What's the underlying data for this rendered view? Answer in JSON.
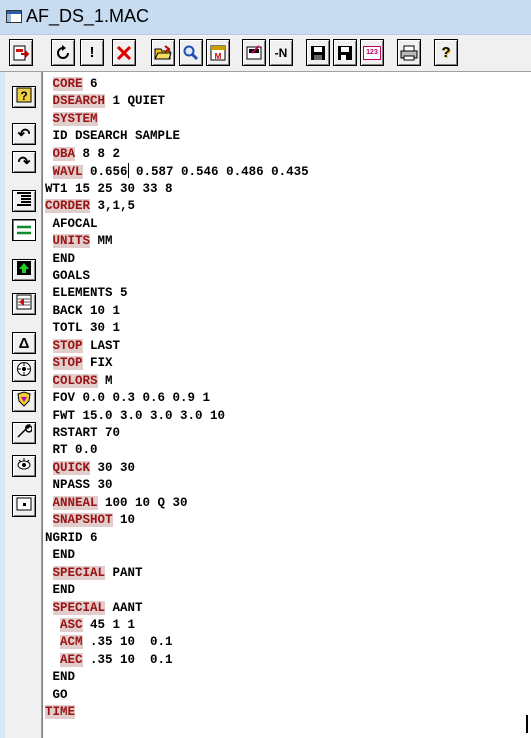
{
  "window": {
    "title": "AF_DS_1.MAC"
  },
  "toolbar": {
    "buttons": [
      {
        "icon": "exit-icon"
      },
      {
        "icon": "refresh-icon"
      },
      {
        "icon": "exclamation-icon",
        "label": "!"
      },
      {
        "icon": "close-red-x-icon"
      },
      {
        "icon": "open-folder-icon"
      },
      {
        "icon": "search-icon"
      },
      {
        "icon": "macro-icon"
      },
      {
        "icon": "edit-icon"
      },
      {
        "icon": "negate-icon",
        "label": "-N"
      },
      {
        "icon": "save-icon"
      },
      {
        "icon": "save-as-icon"
      },
      {
        "icon": "number-icon",
        "label": "123"
      },
      {
        "icon": "print-icon"
      },
      {
        "icon": "help-icon",
        "label": "?"
      }
    ]
  },
  "sidebar": {
    "buttons": [
      {
        "icon": "help-icon",
        "label": "?"
      },
      {
        "icon": "undo-icon",
        "label": "↶"
      },
      {
        "icon": "redo-icon",
        "label": "↷"
      },
      {
        "icon": "indent-icon"
      },
      {
        "icon": "outdent-icon"
      },
      {
        "icon": "up-arrow-icon"
      },
      {
        "icon": "transfer-icon"
      },
      {
        "icon": "triangle-icon",
        "label": "Δ"
      },
      {
        "icon": "target-icon"
      },
      {
        "icon": "shield-icon"
      },
      {
        "icon": "wrench-icon"
      },
      {
        "icon": "eye-icon"
      },
      {
        "icon": "dot-box-icon"
      }
    ]
  },
  "editor": {
    "lines": [
      {
        "indent": " ",
        "kw": "CORE",
        "rest": " 6"
      },
      {
        "indent": " ",
        "kw": "DSEARCH",
        "rest": " 1 QUIET"
      },
      {
        "indent": " ",
        "kw": "SYSTEM",
        "rest": ""
      },
      {
        "indent": " ",
        "kw": "",
        "rest": "ID DSEARCH SAMPLE"
      },
      {
        "indent": " ",
        "kw": "OBA",
        "rest": " 8 8 2"
      },
      {
        "indent": " ",
        "kw": "WAVL",
        "rest_a": " 0.656",
        "cursor": true,
        "rest": " 0.587 0.546 0.486 0.435"
      },
      {
        "indent": "",
        "kw": "",
        "rest": "WT1 15 25 30 33 8"
      },
      {
        "indent": "",
        "kw": "CORDER",
        "rest": " 3,1,5"
      },
      {
        "indent": " ",
        "kw": "",
        "rest": "AFOCAL"
      },
      {
        "indent": " ",
        "kw": "UNITS",
        "rest": " MM"
      },
      {
        "indent": " ",
        "kw": "",
        "rest": "END"
      },
      {
        "indent": " ",
        "kw": "",
        "rest": "GOALS"
      },
      {
        "indent": " ",
        "kw": "",
        "rest": "ELEMENTS 5"
      },
      {
        "indent": " ",
        "kw": "",
        "rest": "BACK 10 1"
      },
      {
        "indent": " ",
        "kw": "",
        "rest": "TOTL 30 1"
      },
      {
        "indent": " ",
        "kw": "STOP",
        "rest": " LAST"
      },
      {
        "indent": " ",
        "kw": "STOP",
        "rest": " FIX"
      },
      {
        "indent": " ",
        "kw": "COLORS",
        "rest": " M"
      },
      {
        "indent": " ",
        "kw": "",
        "rest": "FOV 0.0 0.3 0.6 0.9 1"
      },
      {
        "indent": " ",
        "kw": "",
        "rest": "FWT 15.0 3.0 3.0 3.0 10"
      },
      {
        "indent": " ",
        "kw": "",
        "rest": "RSTART 70"
      },
      {
        "indent": " ",
        "kw": "",
        "rest": "RT 0.0"
      },
      {
        "indent": " ",
        "kw": "QUICK",
        "rest": " 30 30"
      },
      {
        "indent": " ",
        "kw": "",
        "rest": "NPASS 30"
      },
      {
        "indent": " ",
        "kw": "ANNEAL",
        "rest": " 100 10 Q 30"
      },
      {
        "indent": " ",
        "kw": "SNAPSHOT",
        "rest": " 10"
      },
      {
        "indent": "",
        "kw": "",
        "rest": "NGRID 6"
      },
      {
        "indent": " ",
        "kw": "",
        "rest": "END"
      },
      {
        "indent": " ",
        "kw": "SPECIAL",
        "rest": " PANT"
      },
      {
        "indent": " ",
        "kw": "",
        "rest": "END"
      },
      {
        "indent": " ",
        "kw": "SPECIAL",
        "rest": " AANT"
      },
      {
        "indent": "  ",
        "kw": "ASC",
        "rest": " 45 1 1"
      },
      {
        "indent": "  ",
        "kw": "ACM",
        "rest": " .35 10  0.1"
      },
      {
        "indent": "  ",
        "kw": "AEC",
        "rest": " .35 10  0.1"
      },
      {
        "indent": " ",
        "kw": "",
        "rest": "END"
      },
      {
        "indent": " ",
        "kw": "",
        "rest": "GO"
      },
      {
        "indent": "",
        "kw": "TIME",
        "rest": ""
      }
    ]
  },
  "colors": {
    "titlebar": "#c7dcf1",
    "keyword_bg": "#e2cdcd",
    "keyword_fg": "#9a1313"
  }
}
